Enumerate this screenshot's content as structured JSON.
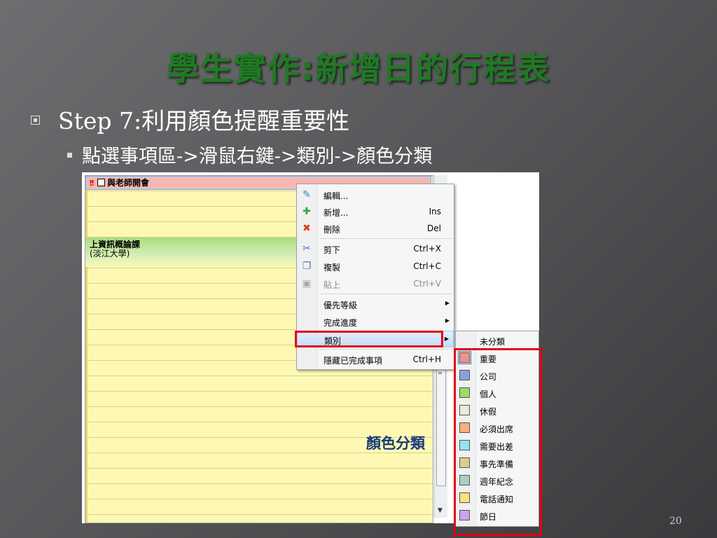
{
  "slide": {
    "title": "學生實作:新增日的行程表",
    "bullet1": "Step 7:利用顏色提醒重要性",
    "bullet2": "點選事項區->滑鼠右鍵->類別->顏色分類",
    "annotation": "顏色分類",
    "page_number": "20"
  },
  "calendar": {
    "appointment1": {
      "importance_mark": "!!",
      "title": "與老師開會"
    },
    "appointment2": {
      "title": "上資訊概論課",
      "location": "(淡江大學)"
    }
  },
  "context_menu": {
    "items": [
      {
        "label": "編輯...",
        "shortcut": "",
        "icon": "edit-icon"
      },
      {
        "label": "新增...",
        "shortcut": "Ins",
        "icon": "plus-icon"
      },
      {
        "label": "刪除",
        "shortcut": "Del",
        "icon": "delete-icon"
      },
      {
        "label": "剪下",
        "shortcut": "Ctrl+X",
        "icon": "scissors-icon"
      },
      {
        "label": "複製",
        "shortcut": "Ctrl+C",
        "icon": "copy-icon"
      },
      {
        "label": "貼上",
        "shortcut": "Ctrl+V",
        "icon": "paste-icon"
      },
      {
        "label": "優先等級",
        "shortcut": ""
      },
      {
        "label": "完成進度",
        "shortcut": ""
      },
      {
        "label": "類別",
        "shortcut": ""
      },
      {
        "label": "隱藏已完成事項",
        "shortcut": "Ctrl+H"
      }
    ]
  },
  "category_submenu": {
    "items": [
      {
        "label": "未分類",
        "color": ""
      },
      {
        "label": "重要",
        "color": "#f4908a"
      },
      {
        "label": "公司",
        "color": "#8aa0e0"
      },
      {
        "label": "個人",
        "color": "#9ed96a"
      },
      {
        "label": "休假",
        "color": "#ecebd9"
      },
      {
        "label": "必須出席",
        "color": "#f7b07a"
      },
      {
        "label": "需要出差",
        "color": "#8ee6f2"
      },
      {
        "label": "事先準備",
        "color": "#d9cf8c"
      },
      {
        "label": "週年紀念",
        "color": "#a9cfc0"
      },
      {
        "label": "電話通知",
        "color": "#fbe27a"
      },
      {
        "label": "節日",
        "color": "#c9a4ec"
      }
    ]
  },
  "colors": {
    "title_green": "#1f7a22",
    "highlight_red": "#e4000f",
    "annotation_blue": "#1a3a7a"
  }
}
